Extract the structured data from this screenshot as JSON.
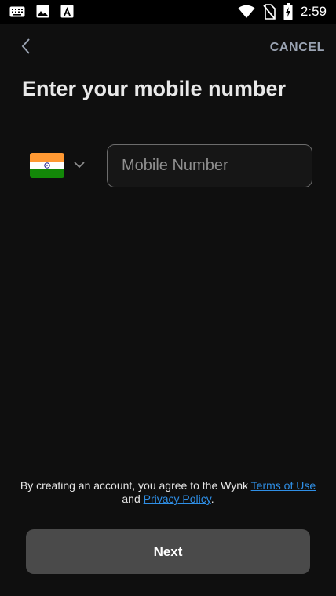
{
  "status_bar": {
    "time": "2:59",
    "left_icons": [
      "keyboard-icon",
      "image-icon",
      "app-a-icon"
    ],
    "right_icons": [
      "wifi-icon",
      "no-sim-icon",
      "battery-charging-icon"
    ]
  },
  "nav": {
    "back_icon": "chevron-left-icon",
    "cancel_label": "CANCEL"
  },
  "title": "Enter your mobile number",
  "country": {
    "flag": "india-flag",
    "dropdown_icon": "chevron-down-icon"
  },
  "phone_input": {
    "placeholder": "Mobile Number",
    "value": ""
  },
  "legal": {
    "prefix": "By creating an account, you agree to the Wynk ",
    "terms_link": "Terms of Use",
    "middle": "and ",
    "privacy_link": "Privacy Policy",
    "suffix": "."
  },
  "next_button": {
    "label": "Next"
  },
  "colors": {
    "background": "#0f0f0f",
    "link": "#2f8fe6",
    "button": "#4a4a4a",
    "cancel": "#9aa3b2"
  }
}
